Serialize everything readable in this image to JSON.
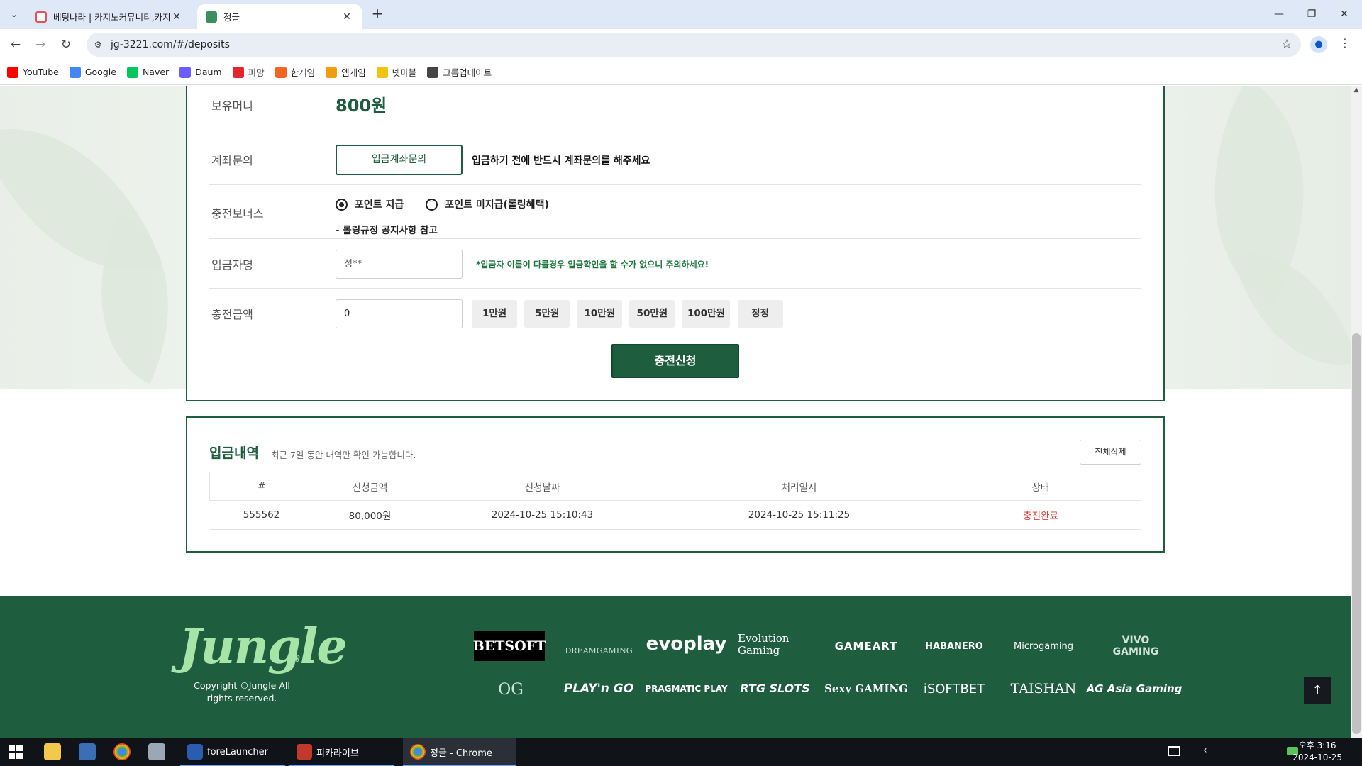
{
  "browser": {
    "tabs": [
      {
        "title": "베팅나라 | 카지노커뮤니티,카지",
        "active": false
      },
      {
        "title": "정글",
        "active": true
      }
    ],
    "url": "jg-3221.com/#/deposits",
    "bookmarks": [
      {
        "label": "YouTube",
        "icon": "youtube-icon",
        "color": "#ff0000"
      },
      {
        "label": "Google",
        "icon": "google-icon",
        "color": "#4285f4"
      },
      {
        "label": "Naver",
        "icon": "naver-icon",
        "color": "#03c75a"
      },
      {
        "label": "Daum",
        "icon": "daum-icon",
        "color": "#6a5cff"
      },
      {
        "label": "피망",
        "icon": "pmang-icon",
        "color": "#e3262b"
      },
      {
        "label": "한게임",
        "icon": "hangame-icon",
        "color": "#f26522"
      },
      {
        "label": "엠게임",
        "icon": "mgame-icon",
        "color": "#f39c12"
      },
      {
        "label": "넷마블",
        "icon": "netmarble-icon",
        "color": "#f1c40f"
      },
      {
        "label": "크롬업데이트",
        "icon": "gear-icon",
        "color": "#444444"
      }
    ]
  },
  "form": {
    "balance_label": "보유머니",
    "balance_value": "800원",
    "account_label": "계좌문의",
    "account_button": "입금계좌문의",
    "account_note": "입금하기 전에 반드시 계좌문의를 해주세요",
    "bonus_label": "충전보너스",
    "bonus_options": [
      "포인트 지급",
      "포인트 미지급(롤링혜택)"
    ],
    "bonus_selected": 0,
    "bonus_note": "- 롤링규정 공지사항 참고",
    "depositor_label": "입금자명",
    "depositor_value": "성**",
    "depositor_warning": "*입금자 이름이 다를경우 입금확인을 할 수가 없으니 주의하세요!",
    "amount_label": "충전금액",
    "amount_value": "0",
    "amount_buttons": [
      "1만원",
      "5만원",
      "10만원",
      "50만원",
      "100만원",
      "정정"
    ],
    "submit_label": "충전신청"
  },
  "history": {
    "title": "입금내역",
    "subtitle": "최근 7일 동안 내역만 확인 가능합니다.",
    "delete_all": "전체삭제",
    "columns": [
      "#",
      "신청금액",
      "신청날짜",
      "처리일시",
      "상태"
    ],
    "rows": [
      {
        "id": "555562",
        "amount": "80,000원",
        "requested": "2024-10-25 15:10:43",
        "processed": "2024-10-25 15:11:25",
        "status": "충전완료"
      }
    ]
  },
  "footer": {
    "logo": "Jungle",
    "copyright": "Copyright ©Jungle All rights reserved.",
    "providers_row1": [
      "BETSOFT",
      "DREAMGAMING",
      "evoplay",
      "Evolution Gaming",
      "GAMEART",
      "HABANERO",
      "Microgaming",
      "VIVO GAMING"
    ],
    "providers_row2": [
      "OG",
      "PLAY'n GO",
      "PRAGMATIC PLAY",
      "RTG SLOTS",
      "Sexy GAMING",
      "iSOFTBET",
      "TAISHAN",
      "AG Asia Gaming"
    ]
  },
  "taskbar": {
    "apps": [
      "foreLauncher",
      "피카라이브",
      "정글 - Chrome"
    ],
    "time": "오후 3:16",
    "date": "2024-10-25"
  },
  "colors": {
    "brand": "#1e5e3f",
    "accent": "#a7e4a8",
    "status_done": "#e53935"
  }
}
